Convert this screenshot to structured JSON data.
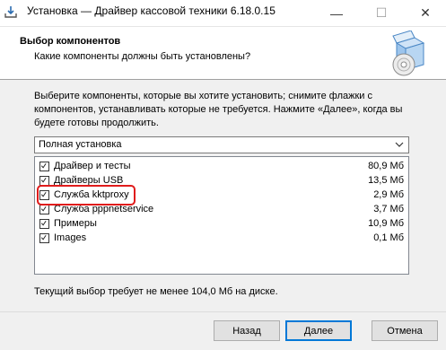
{
  "window": {
    "title": "Установка — Драйвер кассовой техники  6.18.0.15",
    "minimize": "—",
    "maximize": "☐",
    "close": "✕"
  },
  "header": {
    "title": "Выбор компонентов",
    "subtitle": "Какие компоненты должны быть установлены?"
  },
  "description": "Выберите компоненты, которые вы хотите установить; снимите флажки с компонентов, устанавливать которые не требуется. Нажмите «Далее», когда вы будете готовы продолжить.",
  "install_type": {
    "selected": "Полная установка"
  },
  "components": [
    {
      "label": "Драйвер и тесты",
      "size": "80,9 Мб",
      "checked": true
    },
    {
      "label": "Драйверы USB",
      "size": "13,5 Мб",
      "checked": true
    },
    {
      "label": "Служба kktproxy",
      "size": "2,9 Мб",
      "checked": true
    },
    {
      "label": "Служба pppnetservice",
      "size": "3,7 Мб",
      "checked": true
    },
    {
      "label": "Примеры",
      "size": "10,9 Мб",
      "checked": true
    },
    {
      "label": "Images",
      "size": "0,1 Мб",
      "checked": true
    }
  ],
  "space_required": "Текущий выбор требует не менее 104,0 Мб на диске.",
  "buttons": {
    "back": "Назад",
    "next": "Далее",
    "cancel": "Отмена"
  },
  "colors": {
    "highlight": "#e01b1b",
    "default_button_border": "#0078d7"
  }
}
